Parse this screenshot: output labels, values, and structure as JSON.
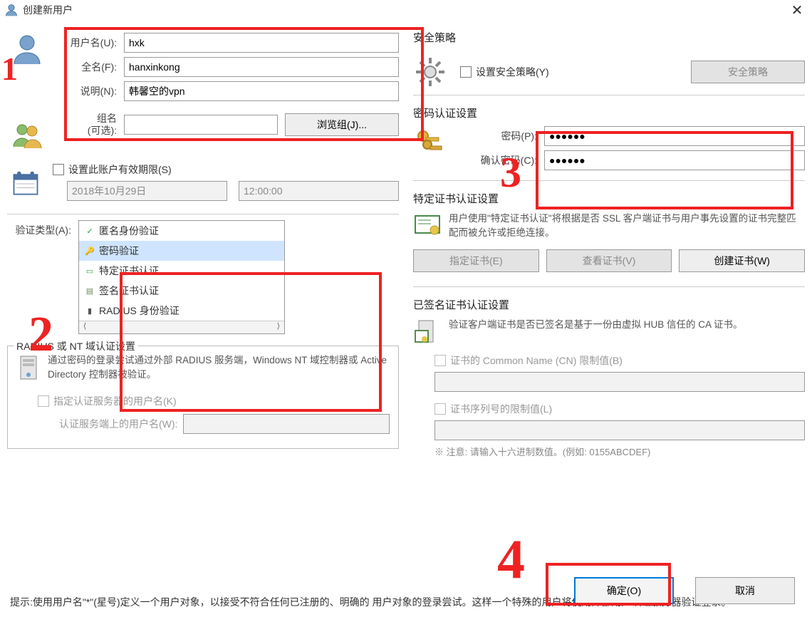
{
  "title": "创建新用户",
  "close_glyph": "✕",
  "user": {
    "username_label": "用户名(U):",
    "username_value": "hxk",
    "fullname_label": "全名(F):",
    "fullname_value": "hanxinkong",
    "desc_label": "说明(N):",
    "desc_value": "韩馨空的vpn"
  },
  "group": {
    "label": "组名\n(可选):",
    "value": "",
    "browse_btn": "浏览组(J)..."
  },
  "expire": {
    "chk_label": "设置此账户有效期限(S)",
    "date": "2018年10月29日",
    "time": "12:00:00"
  },
  "auth": {
    "label": "验证类型(A):",
    "items": [
      {
        "text": "匿名身份验证",
        "icon": "✓",
        "color": "#17a33a"
      },
      {
        "text": "密码验证",
        "icon": "🔑",
        "color": "#c9952a",
        "selected": true
      },
      {
        "text": "特定证书认证",
        "icon": "▭",
        "color": "#3a9a3b"
      },
      {
        "text": "签名证书认证",
        "icon": "▤",
        "color": "#6a8a5c"
      },
      {
        "text": "RADIUS 身份验证",
        "icon": "▮",
        "color": "#555"
      }
    ],
    "hscroll_left": "⟨",
    "hscroll_right": "⟩"
  },
  "radius": {
    "legend": "RADIUS 或 NT 域认证设置",
    "desc": "通过密码的登录尝试通过外部 RADIUS 服务端，Windows NT 域控制器或 Active Directory 控制器被验证。",
    "chk1": "指定认证服务器的用户名(K)",
    "lbl2": "认证服务端上的用户名(W):",
    "val2": ""
  },
  "sec": {
    "title": "安全策略",
    "chk": "设置安全策略(Y)",
    "btn": "安全策略"
  },
  "pwd": {
    "title": "密码认证设置",
    "pwd_label": "密码(P):",
    "pwd_value": "●●●●●●",
    "confirm_label": "确认密码(C):",
    "confirm_value": "●●●●●●"
  },
  "cert": {
    "title": "特定证书认证设置",
    "desc": "用户使用\"特定证书认证\"将根据是否 SSL 客户端证书与用户事先设置的证书完整匹配而被允许或拒绝连接。",
    "btn_specify": "指定证书(E)",
    "btn_view": "查看证书(V)",
    "btn_create": "创建证书(W)"
  },
  "signed": {
    "title": "已签名证书认证设置",
    "desc": "验证客户端证书是否已签名是基于一份由虚拟 HUB 信任的 CA 证书。",
    "chk_cn": "证书的 Common Name (CN) 限制值(B)",
    "cn_val": "",
    "chk_sn": "证书序列号的限制值(L)",
    "sn_val": "",
    "hex_note": "※ 注意: 请输入十六进制数值。(例如: 0155ABCDEF)"
  },
  "footer": {
    "hint": "提示:使用用户名\"*\"(星号)定义一个用户对象，以接受不符合任何已注册的、明确的    用户对象的登录尝试。这样一个特殊的用户将使用外部用户认证服务器验证登录。",
    "ok": "确定(O)",
    "cancel": "取消"
  }
}
